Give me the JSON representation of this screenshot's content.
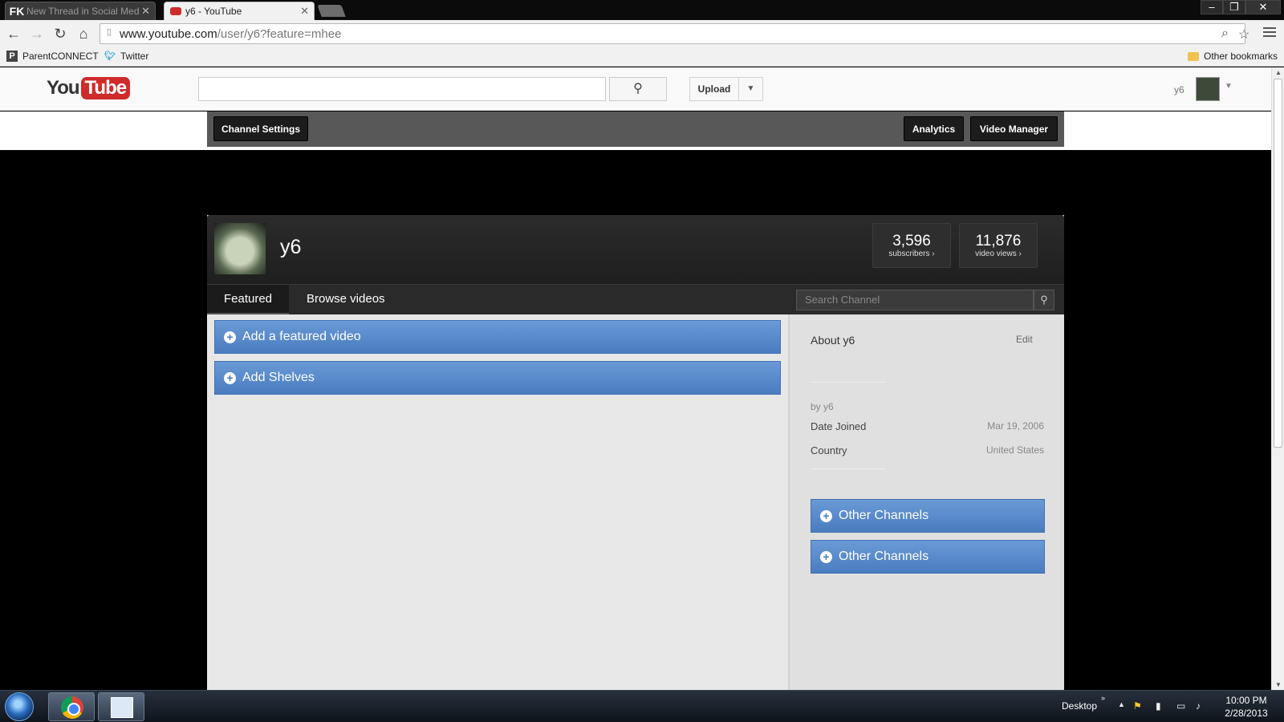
{
  "browser": {
    "tabs": [
      {
        "favicon": "FK",
        "title": "New Thread in Social Med"
      },
      {
        "favicon": "youtube-icon",
        "title": "y6 - YouTube"
      }
    ],
    "url_domain": "www.youtube.com",
    "url_path": "/user/y6?feature=mhee",
    "bookmarks": [
      {
        "icon": "P",
        "label": "ParentCONNECT"
      },
      {
        "icon": "twitter-bird-icon",
        "label": "Twitter"
      }
    ],
    "other_bookmarks": "Other bookmarks"
  },
  "youtube": {
    "logo_you": "You",
    "logo_tube": "Tube",
    "upload_label": "Upload",
    "username": "y6",
    "channel_settings_label": "Channel Settings",
    "analytics_label": "Analytics",
    "video_manager_label": "Video Manager"
  },
  "channel": {
    "name": "y6",
    "subscribers_count": "3,596",
    "subscribers_label": "subscribers ›",
    "views_count": "11,876",
    "views_label": "video views ›",
    "tabs": [
      "Featured",
      "Browse videos"
    ],
    "search_placeholder": "Search Channel",
    "add_featured_label": "Add a featured video",
    "add_shelves_label": "Add Shelves",
    "about_title": "About y6",
    "edit_label": "Edit",
    "by_line": "by y6",
    "date_joined_label": "Date Joined",
    "date_joined_value": "Mar 19, 2006",
    "country_label": "Country",
    "country_value": "United States",
    "other_channels_1": "Other Channels",
    "other_channels_2": "Other Channels"
  },
  "taskbar": {
    "desktop_label": "Desktop",
    "time": "10:00 PM",
    "date": "2/28/2013"
  },
  "colors": {
    "accent_blue": "#4a7cc0",
    "youtube_red": "#d02b2b"
  }
}
